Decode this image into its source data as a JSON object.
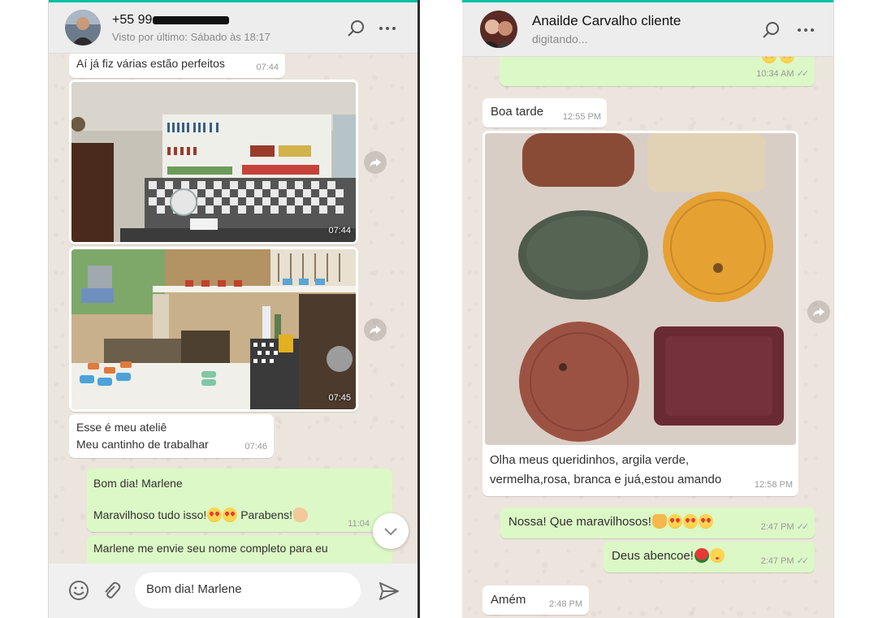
{
  "left_chat": {
    "contact_name": "+55 99",
    "status": "Visto por último: Sábado às 18:17",
    "messages": [
      {
        "text": "Aí já fiz várias estão perfeitos",
        "time": "07:44"
      },
      {
        "photo_time": "07:44"
      },
      {
        "photo_time": "07:45"
      },
      {
        "lines": [
          "Esse é meu ateliê",
          "Meu cantinho de trabalhar"
        ],
        "time": "07:46"
      },
      {
        "line1": "Bom dia! Marlene",
        "line2": "Maravilhoso tudo isso!",
        "line2_after": "Parabens!",
        "time": "11:04"
      },
      {
        "text": "Marlene me envie seu nome completo para eu"
      }
    ],
    "compose_value": "Bom dia! Marlene"
  },
  "right_chat": {
    "contact_name": "Anailde Carvalho cliente",
    "status": "digitando...",
    "messages": [
      {
        "time": "10:34 AM"
      },
      {
        "text": "Boa tarde",
        "time": "12:55 PM"
      },
      {
        "caption_lines": [
          "Olha meus queridinhos, argila verde,",
          "vermelha,rosa, branca e juá,estou amando"
        ],
        "time": "12:58 PM"
      },
      {
        "text": "Nossa! Que maravilhosos!",
        "time": "2:47 PM"
      },
      {
        "text": "Deus abencoe!",
        "time": "2:47 PM"
      },
      {
        "text": "Amém",
        "time": "2:48 PM"
      }
    ]
  },
  "colors": {
    "accent": "#00bfa5",
    "outgoing_bubble": "#dcf8c6",
    "incoming_bubble": "#ffffff",
    "chat_background": "#ece5dd",
    "header": "#ededed"
  },
  "icons": [
    "search-icon",
    "menu-icon",
    "forward-icon",
    "emoji-icon",
    "attach-icon",
    "send-icon",
    "chevron-down-icon",
    "double-check-icon"
  ]
}
